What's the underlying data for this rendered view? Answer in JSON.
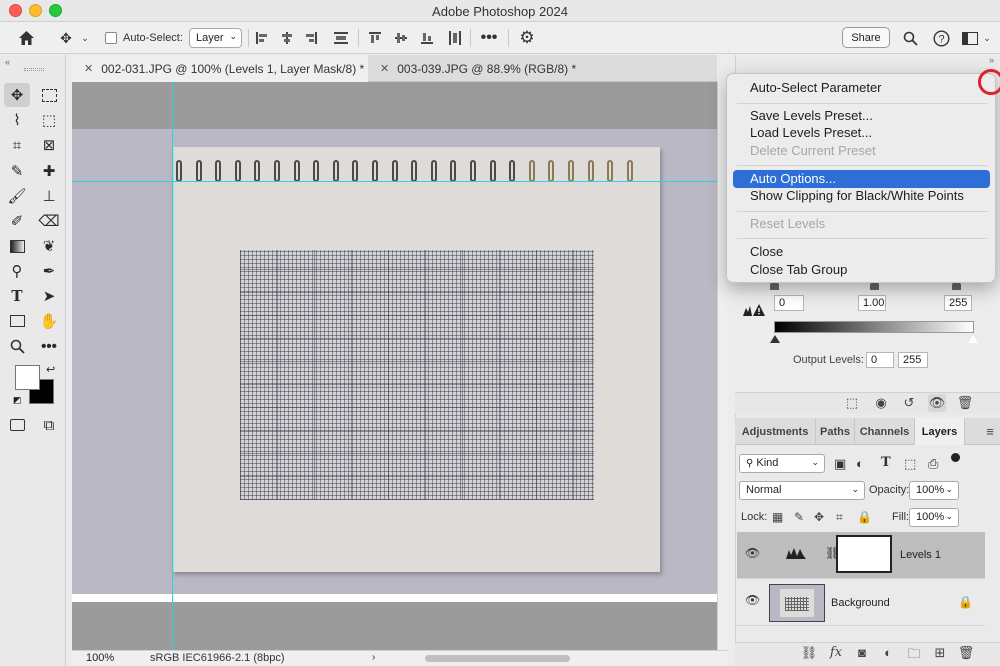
{
  "app": {
    "title": "Adobe Photoshop 2024"
  },
  "options_bar": {
    "auto_select_label": "Auto-Select:",
    "auto_select_target": "Layer",
    "share_label": "Share"
  },
  "tabs": [
    {
      "label": "002-031.JPG @ 100% (Levels 1, Layer Mask/8) *",
      "active": true
    },
    {
      "label": "003-039.JPG @ 88.9% (RGB/8) *",
      "active": false
    }
  ],
  "status": {
    "zoom": "100%",
    "profile": "sRGB IEC61966-2.1 (8bpc)"
  },
  "flyout_menu": {
    "items": [
      {
        "label": "Auto-Select Parameter",
        "state": "normal"
      },
      {
        "label": "Save Levels Preset...",
        "state": "normal"
      },
      {
        "label": "Load Levels Preset...",
        "state": "normal"
      },
      {
        "label": "Delete Current Preset",
        "state": "disabled"
      },
      {
        "label": "Auto Options...",
        "state": "highlighted"
      },
      {
        "label": "Show Clipping for Black/White Points",
        "state": "normal"
      },
      {
        "label": "Reset Levels",
        "state": "disabled"
      },
      {
        "label": "Close",
        "state": "normal"
      },
      {
        "label": "Close Tab Group",
        "state": "normal"
      }
    ]
  },
  "levels": {
    "input_black": "0",
    "input_gamma": "1.00",
    "input_white": "255",
    "output_label": "Output Levels:",
    "output_black": "0",
    "output_white": "255"
  },
  "layers_panel": {
    "tabs": [
      "Adjustments",
      "Paths",
      "Channels",
      "Layers"
    ],
    "active_tab": "Layers",
    "filter_kind": "Kind",
    "blend_mode": "Normal",
    "opacity_label": "Opacity:",
    "opacity_value": "100%",
    "lock_label": "Lock:",
    "fill_label": "Fill:",
    "fill_value": "100%",
    "layers": [
      {
        "name": "Levels 1",
        "selected": true
      },
      {
        "name": "Background",
        "selected": false
      }
    ]
  },
  "colors": {
    "menu_highlight": "#2d6fd7",
    "guide": "#27d4e0",
    "annotation_circle": "#e0202b"
  }
}
